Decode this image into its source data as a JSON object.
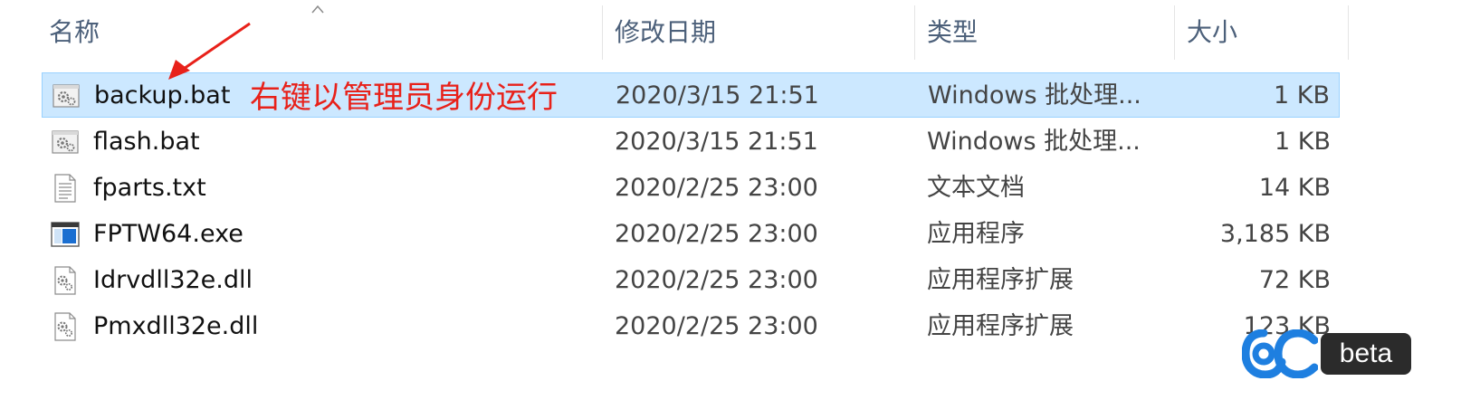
{
  "columns": {
    "name": "名称",
    "date": "修改日期",
    "type": "类型",
    "size": "大小"
  },
  "sort": {
    "column": "name",
    "direction": "ascending",
    "icon": "sort-up-icon"
  },
  "files": [
    {
      "name": "backup.bat",
      "date": "2020/3/15 21:51",
      "type": "Windows 批处理...",
      "size": "1 KB",
      "icon": "batch-file-icon",
      "selected": true
    },
    {
      "name": "flash.bat",
      "date": "2020/3/15 21:51",
      "type": "Windows 批处理...",
      "size": "1 KB",
      "icon": "batch-file-icon",
      "selected": false
    },
    {
      "name": "fparts.txt",
      "date": "2020/2/25 23:00",
      "type": "文本文档",
      "size": "14 KB",
      "icon": "text-file-icon",
      "selected": false
    },
    {
      "name": "FPTW64.exe",
      "date": "2020/2/25 23:00",
      "type": "应用程序",
      "size": "3,185 KB",
      "icon": "application-icon",
      "selected": false
    },
    {
      "name": "Idrvdll32e.dll",
      "date": "2020/2/25 23:00",
      "type": "应用程序扩展",
      "size": "72 KB",
      "icon": "dll-file-icon",
      "selected": false
    },
    {
      "name": "Pmxdll32e.dll",
      "date": "2020/2/25 23:00",
      "type": "应用程序扩展",
      "size": "123 KB",
      "icon": "dll-file-icon",
      "selected": false
    }
  ],
  "annotation": {
    "text": "右键以管理员身份运行",
    "color": "#e8211a",
    "icon": "red-arrow-icon"
  },
  "watermark": {
    "badge_text": "beta",
    "logo": "pc-logo-icon",
    "logo_color": "#1e7fe0"
  },
  "colors": {
    "selection_bg": "#cce8ff",
    "selection_border": "#99d1ff",
    "header_text": "#4c607a"
  }
}
